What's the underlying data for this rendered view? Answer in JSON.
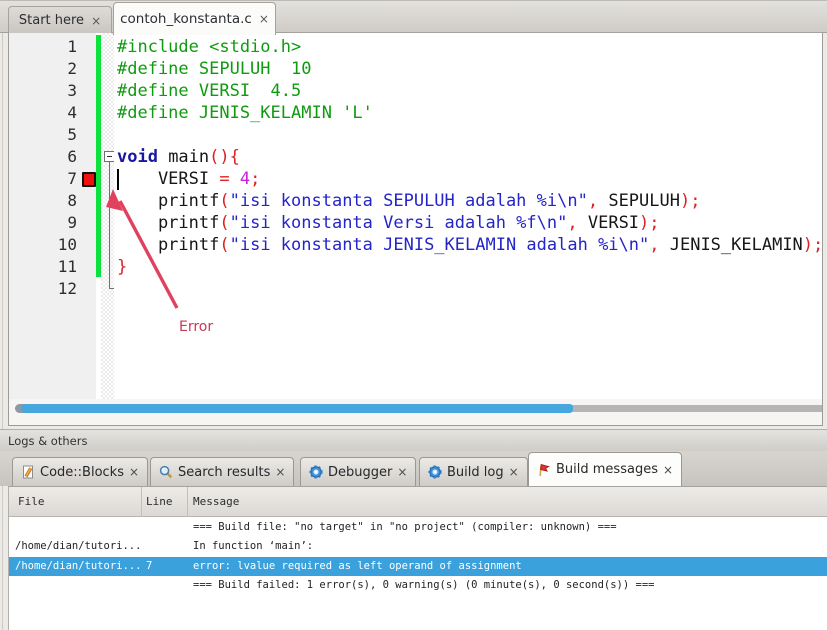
{
  "editor_notebook": {
    "close_glyph": "×",
    "tabs": [
      {
        "label": "Start here",
        "active": false
      },
      {
        "label": "contoh_konstanta.c",
        "active": true
      }
    ]
  },
  "editor": {
    "caret_line": 7,
    "error_marker_line": 7,
    "fold_start_line": 6,
    "annotation": {
      "label": "Error"
    },
    "lines": [
      {
        "num": "1",
        "segs": [
          {
            "t": "#include <stdio.h>",
            "k": "pre"
          }
        ]
      },
      {
        "num": "2",
        "segs": [
          {
            "t": "#define SEPULUH  10",
            "k": "pre"
          }
        ]
      },
      {
        "num": "3",
        "segs": [
          {
            "t": "#define VERSI  4.5",
            "k": "pre"
          }
        ]
      },
      {
        "num": "4",
        "segs": [
          {
            "t": "#define JENIS_KELAMIN 'L'",
            "k": "pre"
          }
        ]
      },
      {
        "num": "5",
        "segs": []
      },
      {
        "num": "6",
        "segs": [
          {
            "t": "void",
            "k": "kw"
          },
          {
            "t": " main",
            "k": "id"
          },
          {
            "t": "(){",
            "k": "op"
          }
        ]
      },
      {
        "num": "7",
        "segs": [
          {
            "t": "    VERSI ",
            "k": "id"
          },
          {
            "t": "=",
            "k": "op"
          },
          {
            "t": " ",
            "k": "id"
          },
          {
            "t": "4",
            "k": "num"
          },
          {
            "t": ";",
            "k": "op"
          }
        ]
      },
      {
        "num": "8",
        "segs": [
          {
            "t": "    printf",
            "k": "id"
          },
          {
            "t": "(",
            "k": "op"
          },
          {
            "t": "\"isi konstanta SEPULUH adalah %i\\n\"",
            "k": "str"
          },
          {
            "t": ",",
            "k": "op"
          },
          {
            "t": " SEPULUH",
            "k": "id"
          },
          {
            "t": ");",
            "k": "op"
          }
        ]
      },
      {
        "num": "9",
        "segs": [
          {
            "t": "    printf",
            "k": "id"
          },
          {
            "t": "(",
            "k": "op"
          },
          {
            "t": "\"isi konstanta Versi adalah %f\\n\"",
            "k": "str"
          },
          {
            "t": ",",
            "k": "op"
          },
          {
            "t": " VERSI",
            "k": "id"
          },
          {
            "t": ");",
            "k": "op"
          }
        ]
      },
      {
        "num": "10",
        "segs": [
          {
            "t": "    printf",
            "k": "id"
          },
          {
            "t": "(",
            "k": "op"
          },
          {
            "t": "\"isi konstanta JENIS_KELAMIN adalah %i\\n\"",
            "k": "str"
          },
          {
            "t": ",",
            "k": "op"
          },
          {
            "t": " JENIS_KELAMIN",
            "k": "id"
          },
          {
            "t": ");",
            "k": "op"
          }
        ]
      },
      {
        "num": "11",
        "segs": [
          {
            "t": "}",
            "k": "op"
          }
        ]
      },
      {
        "num": "12",
        "segs": []
      }
    ]
  },
  "logs_panel": {
    "caption": "Logs & others",
    "close_glyph": "×",
    "tabs": [
      {
        "label": "Code::Blocks",
        "icon": "codeblocks-icon",
        "active": false
      },
      {
        "label": "Search results",
        "icon": "search-icon",
        "active": false
      },
      {
        "label": "Debugger",
        "icon": "debugger-gear-icon",
        "active": false
      },
      {
        "label": "Build log",
        "icon": "build-log-gear-icon",
        "active": false
      },
      {
        "label": "Build messages",
        "icon": "build-flag-icon",
        "active": true
      }
    ],
    "table": {
      "columns": [
        "File",
        "Line",
        "Message"
      ],
      "rows": [
        {
          "file": "",
          "line": "",
          "message": "=== Build file: \"no target\" in \"no project\" (compiler: unknown) ===",
          "selected": false
        },
        {
          "file": "/home/dian/tutori...",
          "line": "",
          "message": "In function ‘main’:",
          "selected": false
        },
        {
          "file": "/home/dian/tutori...",
          "line": "7",
          "message": "error: lvalue required as left operand of assignment",
          "selected": true
        },
        {
          "file": "",
          "line": "",
          "message": "=== Build failed: 1 error(s), 0 warning(s) (0 minute(s), 0 second(s)) ===",
          "selected": false
        }
      ]
    }
  },
  "colors": {
    "accent_selection": "#3aa1dc",
    "scrollbar_thumb": "#45a7dd",
    "change_bar": "#0ce23c",
    "error_marker": "#ee1111",
    "annotation": "#c93a55",
    "tok_preprocessor": "#0f9b0f",
    "tok_keyword": "#1717a3",
    "tok_string": "#2424c8",
    "tok_operator": "#dd2020",
    "tok_number": "#cc22dd"
  }
}
